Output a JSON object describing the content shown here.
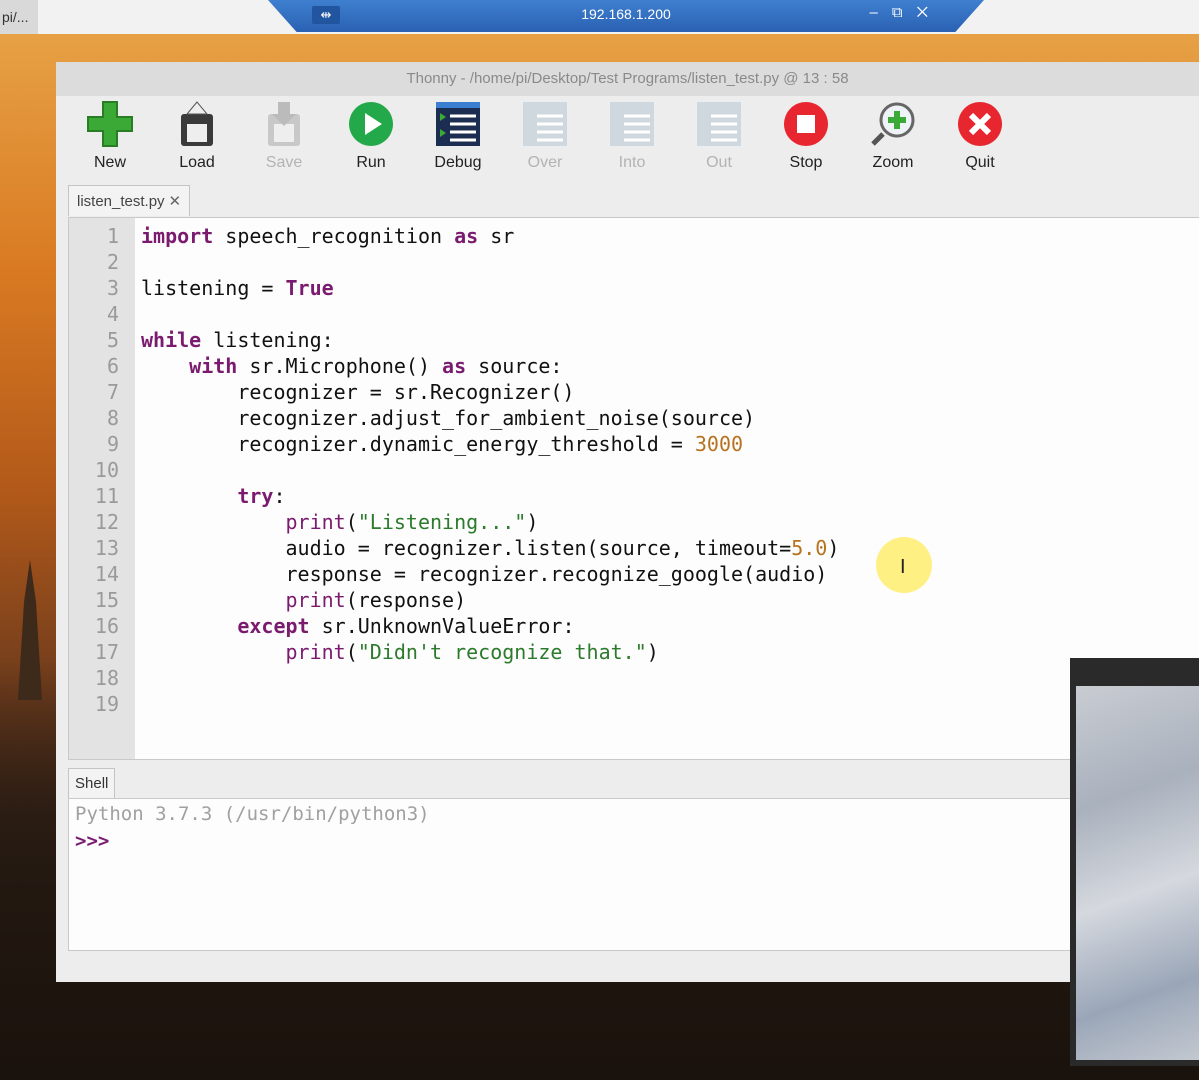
{
  "taskbar": {
    "left_label": "pi/..."
  },
  "vnc": {
    "title": "192.168.1.200",
    "pin": "⇹",
    "controls": "–⧉✕"
  },
  "window": {
    "title": "Thonny  -  /home/pi/Desktop/Test Programs/listen_test.py  @  13 : 58"
  },
  "toolbar": {
    "new": "New",
    "load": "Load",
    "save": "Save",
    "run": "Run",
    "debug": "Debug",
    "over": "Over",
    "into": "Into",
    "out": "Out",
    "stop": "Stop",
    "zoom": "Zoom",
    "quit": "Quit"
  },
  "editor": {
    "tab_label": "listen_test.py",
    "tab_close": "✕",
    "line_numbers": [
      "1",
      "2",
      "3",
      "4",
      "5",
      "6",
      "7",
      "8",
      "9",
      "10",
      "11",
      "12",
      "13",
      "14",
      "15",
      "16",
      "17",
      "18",
      "19"
    ]
  },
  "code": {
    "l1_a": "import",
    "l1_b": " speech_recognition ",
    "l1_c": "as",
    "l1_d": " sr",
    "l3_a": "listening = ",
    "l3_b": "True",
    "l5_a": "while",
    "l5_b": " listening:",
    "l6_a": "    with",
    "l6_b": " sr.Microphone() ",
    "l6_c": "as",
    "l6_d": " source:",
    "l7": "        recognizer = sr.Recognizer()",
    "l8": "        recognizer.adjust_for_ambient_noise(source)",
    "l9_a": "        recognizer.dynamic_energy_threshold = ",
    "l9_b": "3000",
    "l11_a": "        try",
    "l11_b": ":",
    "l12_a": "            print",
    "l12_b": "(",
    "l12_c": "\"Listening...\"",
    "l12_d": ")",
    "l13_a": "            audio = recognizer.listen(source, timeout=",
    "l13_b": "5.0",
    "l13_c": ")",
    "l14": "            response = recognizer.recognize_google(audio)",
    "l15_a": "            print",
    "l15_b": "(response)",
    "l16_a": "        except",
    "l16_b": " sr.UnknownValueError:",
    "l17_a": "            print",
    "l17_b": "(",
    "l17_c": "\"Didn't recognize that.\"",
    "l17_d": ")"
  },
  "shell": {
    "tab_label": "Shell",
    "banner": "Python 3.7.3 (/usr/bin/python3)",
    "prompt": ">>>"
  },
  "colors": {
    "keyword": "#7a1b6f",
    "string": "#2c7a2c",
    "number": "#b8721e",
    "vnc_bar": "#2a61b3"
  }
}
